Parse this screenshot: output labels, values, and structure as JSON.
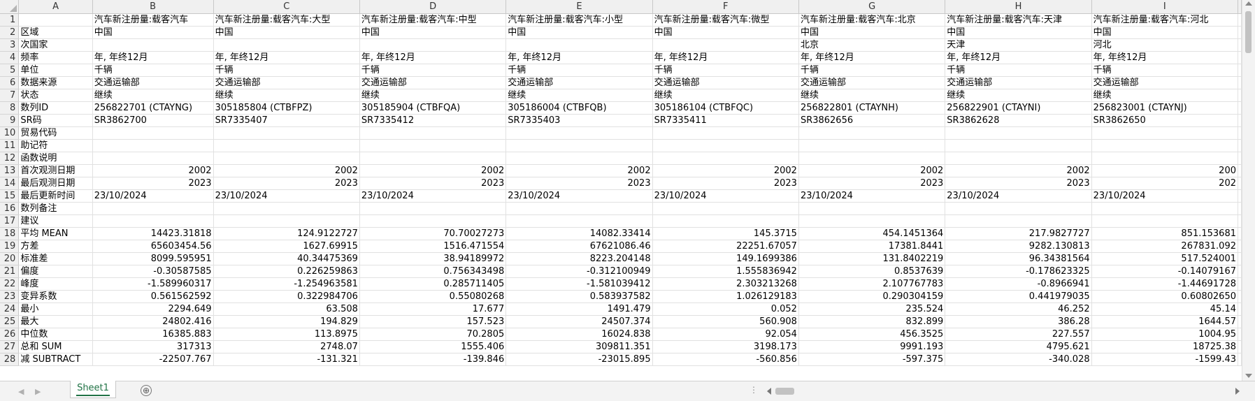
{
  "columns": [
    "A",
    "B",
    "C",
    "D",
    "E",
    "F",
    "G",
    "H",
    "I"
  ],
  "rows": [
    {
      "n": "1",
      "cells": [
        "",
        "汽车新注册量:载客汽车",
        "汽车新注册量:载客汽车:大型",
        "汽车新注册量:载客汽车:中型",
        "汽车新注册量:载客汽车:小型",
        "汽车新注册量:载客汽车:微型",
        "汽车新注册量:载客汽车:北京",
        "汽车新注册量:载客汽车:天津",
        "汽车新注册量:载客汽车:河北"
      ]
    },
    {
      "n": "2",
      "cells": [
        "区域",
        "中国",
        "中国",
        "中国",
        "中国",
        "中国",
        "中国",
        "中国",
        "中国"
      ]
    },
    {
      "n": "3",
      "cells": [
        "次国家",
        "",
        "",
        "",
        "",
        "",
        "北京",
        "天津",
        "河北"
      ]
    },
    {
      "n": "4",
      "cells": [
        "频率",
        "年, 年终12月",
        "年, 年终12月",
        "年, 年终12月",
        "年, 年终12月",
        "年, 年终12月",
        "年, 年终12月",
        "年, 年终12月",
        "年, 年终12月"
      ]
    },
    {
      "n": "5",
      "cells": [
        "单位",
        "千辆",
        "千辆",
        "千辆",
        "千辆",
        "千辆",
        "千辆",
        "千辆",
        "千辆"
      ]
    },
    {
      "n": "6",
      "cells": [
        "数据来源",
        "交通运输部",
        "交通运输部",
        "交通运输部",
        "交通运输部",
        "交通运输部",
        "交通运输部",
        "交通运输部",
        "交通运输部"
      ]
    },
    {
      "n": "7",
      "cells": [
        "状态",
        "继续",
        "继续",
        "继续",
        "继续",
        "继续",
        "继续",
        "继续",
        "继续"
      ]
    },
    {
      "n": "8",
      "cells": [
        "数列ID",
        "256822701 (CTAYNG)",
        "305185804 (CTBFPZ)",
        "305185904 (CTBFQA)",
        "305186004 (CTBFQB)",
        "305186104 (CTBFQC)",
        "256822801 (CTAYNH)",
        "256822901 (CTAYNI)",
        "256823001 (CTAYNJ)"
      ]
    },
    {
      "n": "9",
      "cells": [
        "SR码",
        "SR3862700",
        "SR7335407",
        "SR7335412",
        "SR7335403",
        "SR7335411",
        "SR3862656",
        "SR3862628",
        "SR3862650"
      ]
    },
    {
      "n": "10",
      "cells": [
        "贸易代码",
        "",
        "",
        "",
        "",
        "",
        "",
        "",
        ""
      ]
    },
    {
      "n": "11",
      "cells": [
        "助记符",
        "",
        "",
        "",
        "",
        "",
        "",
        "",
        ""
      ]
    },
    {
      "n": "12",
      "cells": [
        "函数说明",
        "",
        "",
        "",
        "",
        "",
        "",
        "",
        ""
      ]
    },
    {
      "n": "13",
      "cells": [
        "首次观测日期",
        "2002",
        "2002",
        "2002",
        "2002",
        "2002",
        "2002",
        "2002",
        "200"
      ]
    },
    {
      "n": "14",
      "cells": [
        "最后观测日期",
        "2023",
        "2023",
        "2023",
        "2023",
        "2023",
        "2023",
        "2023",
        "202"
      ]
    },
    {
      "n": "15",
      "cells": [
        "最后更新时间",
        "23/10/2024",
        "23/10/2024",
        "23/10/2024",
        "23/10/2024",
        "23/10/2024",
        "23/10/2024",
        "23/10/2024",
        "23/10/2024"
      ]
    },
    {
      "n": "16",
      "cells": [
        "数列备注",
        "",
        "",
        "",
        "",
        "",
        "",
        "",
        ""
      ]
    },
    {
      "n": "17",
      "cells": [
        "建议",
        "",
        "",
        "",
        "",
        "",
        "",
        "",
        ""
      ]
    },
    {
      "n": "18",
      "cells": [
        "平均 MEAN",
        "14423.31818",
        "124.9122727",
        "70.70027273",
        "14082.33414",
        "145.3715",
        "454.1451364",
        "217.9827727",
        "851.153681"
      ]
    },
    {
      "n": "19",
      "cells": [
        "方差",
        "65603454.56",
        "1627.69915",
        "1516.471554",
        "67621086.46",
        "22251.67057",
        "17381.8441",
        "9282.130813",
        "267831.092"
      ]
    },
    {
      "n": "20",
      "cells": [
        "标准差",
        "8099.595951",
        "40.34475369",
        "38.94189972",
        "8223.204148",
        "149.1699386",
        "131.8402219",
        "96.34381564",
        "517.524001"
      ]
    },
    {
      "n": "21",
      "cells": [
        "偏度",
        "-0.30587585",
        "0.226259863",
        "0.756343498",
        "-0.312100949",
        "1.555836942",
        "0.8537639",
        "-0.178623325",
        "-0.14079167"
      ]
    },
    {
      "n": "22",
      "cells": [
        "峰度",
        "-1.589960317",
        "-1.254963581",
        "0.285711405",
        "-1.581039412",
        "2.303213268",
        "2.107767783",
        "-0.8966941",
        "-1.44691728"
      ]
    },
    {
      "n": "23",
      "cells": [
        "变异系数",
        "0.561562592",
        "0.322984706",
        "0.55080268",
        "0.583937582",
        "1.026129183",
        "0.290304159",
        "0.441979035",
        "0.60802650"
      ]
    },
    {
      "n": "24",
      "cells": [
        "最小",
        "2294.649",
        "63.508",
        "17.677",
        "1491.479",
        "0.052",
        "235.524",
        "46.252",
        "45.14"
      ]
    },
    {
      "n": "25",
      "cells": [
        "最大",
        "24802.416",
        "194.829",
        "157.523",
        "24507.374",
        "560.908",
        "832.899",
        "386.28",
        "1644.57"
      ]
    },
    {
      "n": "26",
      "cells": [
        "中位数",
        "16385.883",
        "113.8975",
        "70.2805",
        "16024.838",
        "92.054",
        "456.3525",
        "227.557",
        "1004.95"
      ]
    },
    {
      "n": "27",
      "cells": [
        "总和 SUM",
        "317313",
        "2748.07",
        "1555.406",
        "309811.351",
        "3198.173",
        "9991.193",
        "4795.621",
        "18725.38"
      ]
    },
    {
      "n": "28",
      "cells": [
        "减 SUBTRACT",
        "-22507.767",
        "-131.321",
        "-139.846",
        "-23015.895",
        "-560.856",
        "-597.375",
        "-340.028",
        "-1599.43"
      ]
    }
  ],
  "sheet_tab": "Sheet1",
  "add_sheet_symbol": "⊕",
  "hdots": "⋮"
}
